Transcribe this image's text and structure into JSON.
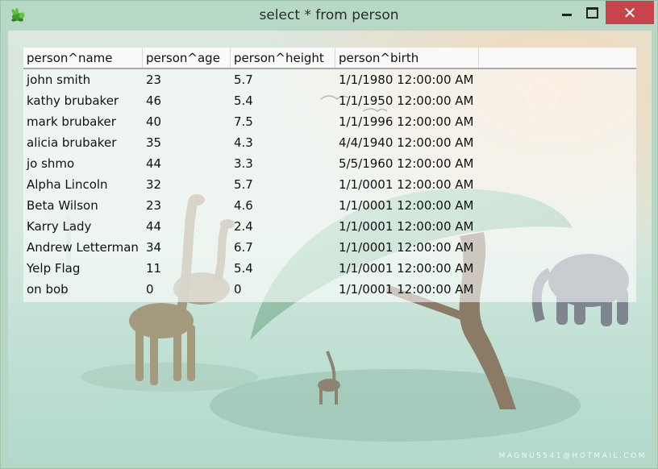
{
  "window": {
    "title": "select * from person",
    "app_icon": "rabbit-app-icon",
    "buttons": {
      "minimize_icon": "minimize-icon",
      "maximize_icon": "maximize-icon",
      "close_icon": "close-icon",
      "close_glyph": "✕"
    },
    "titlebar_color": "#b7d8c4",
    "close_color": "#c7454a"
  },
  "grid": {
    "columns": [
      "person^name",
      "person^age",
      "person^height",
      "person^birth"
    ],
    "rows": [
      [
        "john smith",
        "23",
        "5.7",
        "1/1/1980 12:00:00 AM"
      ],
      [
        "kathy brubaker",
        "46",
        "5.4",
        "1/1/1950 12:00:00 AM"
      ],
      [
        "mark brubaker",
        "40",
        "7.5",
        "1/1/1996 12:00:00 AM"
      ],
      [
        "alicia brubaker",
        "35",
        "4.3",
        "4/4/1940 12:00:00 AM"
      ],
      [
        "jo shmo",
        "44",
        "3.3",
        "5/5/1960 12:00:00 AM"
      ],
      [
        "Alpha Lincoln",
        "32",
        "5.7",
        "1/1/0001 12:00:00 AM"
      ],
      [
        "Beta Wilson",
        "23",
        "4.6",
        "1/1/0001 12:00:00 AM"
      ],
      [
        "Karry Lady",
        "44",
        "2.4",
        "1/1/0001 12:00:00 AM"
      ],
      [
        "Andrew Letterman",
        "34",
        "6.7",
        "1/1/0001 12:00:00 AM"
      ],
      [
        "Yelp Flag",
        "11",
        "5.4",
        "1/1/0001 12:00:00 AM"
      ],
      [
        "on bob",
        "0",
        "0",
        "1/1/0001 12:00:00 AM"
      ]
    ]
  },
  "wallpaper": {
    "watermark": "MAGNUS541@HOTMAIL.COM"
  }
}
